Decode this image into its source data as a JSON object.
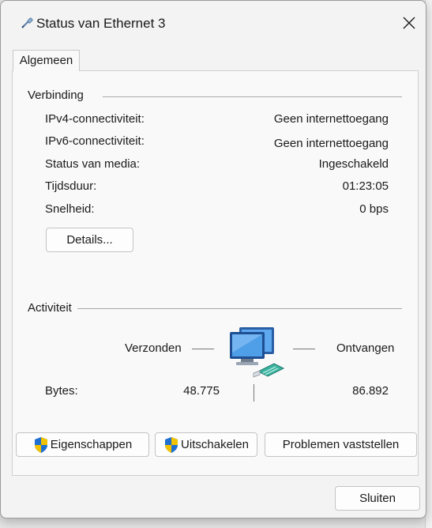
{
  "window": {
    "title": "Status van Ethernet 3",
    "close_label": "Sluiten"
  },
  "tabs": [
    {
      "label": "Algemeen",
      "selected": true
    }
  ],
  "connection": {
    "group_label": "Verbinding",
    "rows": [
      {
        "label": "IPv4-connectiviteit:",
        "value": "Geen internettoegang"
      },
      {
        "label": "IPv6-connectiviteit:",
        "value": "Geen internettoegang"
      },
      {
        "label": "Status van media:",
        "value": "Ingeschakeld"
      },
      {
        "label": "Tijdsduur:",
        "value": "01:23:05"
      },
      {
        "label": "Snelheid:",
        "value": "0 bps"
      }
    ],
    "details_label": "Details..."
  },
  "activity": {
    "group_label": "Activiteit",
    "sent_label": "Verzonden",
    "received_label": "Ontvangen",
    "bytes_label": "Bytes:",
    "bytes_sent": "48.775",
    "bytes_received": "86.892"
  },
  "actions": {
    "properties_label": "Eigenschappen",
    "disable_label": "Uitschakelen",
    "diagnose_label": "Problemen vaststellen"
  },
  "icons": {
    "title": "ethernet-cable-icon",
    "activity": "network-computers-icon",
    "shield": "uac-shield-icon"
  },
  "colors": {
    "shield_blue": "#1e6fd1",
    "shield_yellow": "#f2c200",
    "monitor_blue": "#3d8fe0"
  }
}
